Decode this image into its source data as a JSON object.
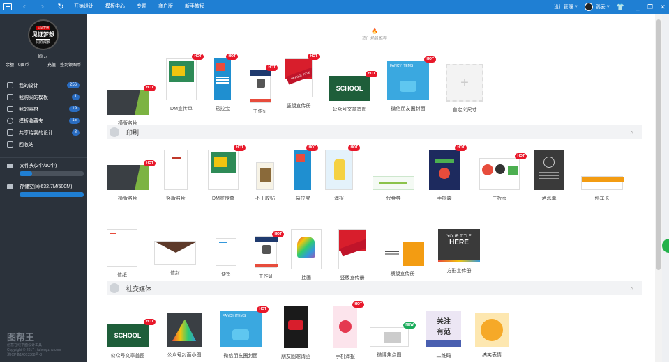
{
  "topbar": {
    "nav": [
      "‹",
      "›",
      "↻"
    ],
    "menu": [
      "开始设计",
      "模板中心",
      "专题",
      "商户版",
      "新手教程"
    ],
    "design_manage": "设计管理",
    "user": "鸥云",
    "controls": [
      "_",
      "❐",
      "✕"
    ]
  },
  "sidebar": {
    "avatar_badge": "见证梦想",
    "avatar_title": "见证梦想",
    "avatar_sub": "同你成长",
    "name": "鸥云",
    "balance": "余额：0图币",
    "recharge": "充值",
    "checkin": "签到领图币",
    "items": [
      {
        "label": "我的设计",
        "count": "256"
      },
      {
        "label": "我购买的模板",
        "count": "1"
      },
      {
        "label": "我的素材",
        "count": "19"
      },
      {
        "label": "模板收藏夹",
        "count": "15"
      },
      {
        "label": "共享给我的设计",
        "count": "8"
      },
      {
        "label": "回收站",
        "count": ""
      }
    ],
    "folder": "文件夹(2个/10个)",
    "folder_pct": 20,
    "storage": "存储空间(632.7M/500M)",
    "storage_pct": 100,
    "footer_logo": "图帮王",
    "footer_lines": [
      "创意在线平面设计工具",
      "Copyright © 2017 , tuhengzhu.com",
      "浙ICP备14013368号-8"
    ]
  },
  "hot_title": "热门场景推荐",
  "hot": [
    {
      "label": "横版名片",
      "badge": "HOT"
    },
    {
      "label": "DM宣传单",
      "badge": "HOT"
    },
    {
      "label": "易拉宝",
      "badge": "HOT"
    },
    {
      "label": "工作证",
      "badge": "HOT"
    },
    {
      "label": "竖版宣传册",
      "badge": "HOT"
    },
    {
      "label": "公众号文章首图",
      "badge": "HOT"
    },
    {
      "label": "微信朋友圈封面",
      "badge": "HOT"
    },
    {
      "label": "自定义尺寸",
      "badge": ""
    }
  ],
  "section_print": "印刷",
  "print_row1": [
    {
      "label": "横版名片",
      "badge": "HOT"
    },
    {
      "label": "竖版名片",
      "badge": ""
    },
    {
      "label": "DM宣传单",
      "badge": "HOT"
    },
    {
      "label": "不干胶贴",
      "badge": ""
    },
    {
      "label": "易拉宝",
      "badge": "HOT"
    },
    {
      "label": "海报",
      "badge": "HOT"
    },
    {
      "label": "代金券",
      "badge": ""
    },
    {
      "label": "手提袋",
      "badge": "HOT"
    },
    {
      "label": "三折页",
      "badge": "HOT"
    },
    {
      "label": "酒水单",
      "badge": ""
    },
    {
      "label": "停车卡",
      "badge": ""
    }
  ],
  "print_row2": [
    {
      "label": "信纸",
      "badge": ""
    },
    {
      "label": "信封",
      "badge": ""
    },
    {
      "label": "便签",
      "badge": ""
    },
    {
      "label": "工作证",
      "badge": "HOT"
    },
    {
      "label": "挂画",
      "badge": ""
    },
    {
      "label": "竖版宣传册",
      "badge": ""
    },
    {
      "label": "横版宣传册",
      "badge": ""
    },
    {
      "label": "方形宣传册",
      "badge": ""
    }
  ],
  "section_social": "社交媒体",
  "social": [
    {
      "label": "公众号文章首图",
      "badge": "HOT"
    },
    {
      "label": "公众号封面小图",
      "badge": ""
    },
    {
      "label": "微信朋友圈封面",
      "badge": "HOT"
    },
    {
      "label": "朋友圈邀请函",
      "badge": ""
    },
    {
      "label": "手机海报",
      "badge": "HOT"
    },
    {
      "label": "微博焦点图",
      "badge": "NEW"
    },
    {
      "label": "二维码",
      "badge": ""
    },
    {
      "label": "搞笑表情",
      "badge": ""
    }
  ],
  "thumb_text": {
    "school": "SCHOOL",
    "fancy": "FANCY ITEMS",
    "report": "REPORT TITLE",
    "your_title": "YOUR TITLE",
    "here": "HERE",
    "qr_line1": "关注",
    "qr_line2": "有范",
    "plus": "+"
  },
  "colors": {
    "topbar": "#1f7fd3",
    "sidebar": "#2b323b",
    "hot": "#e8182a",
    "new": "#1aab5a",
    "count": "#2a6dc2"
  }
}
